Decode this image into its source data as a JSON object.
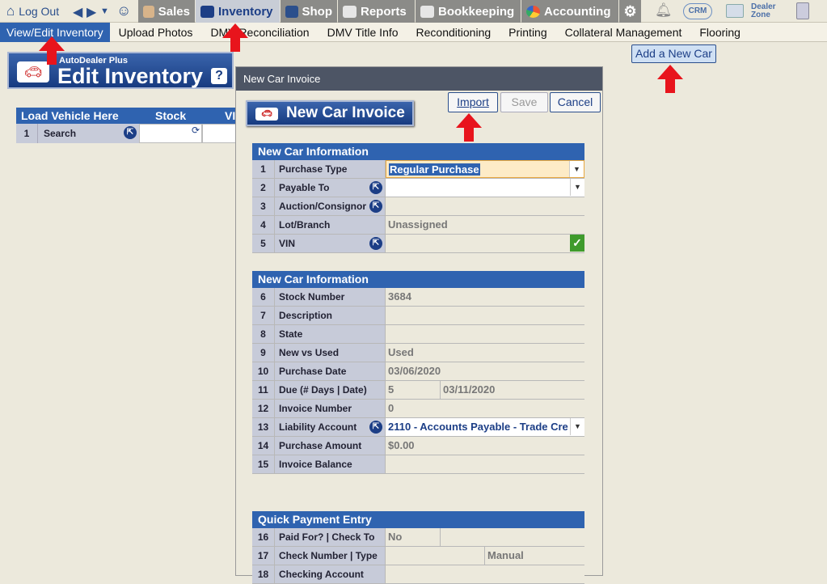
{
  "topnav": {
    "logout": "Log Out",
    "tabs": [
      {
        "label": "Sales",
        "icon": "salesperson-icon"
      },
      {
        "label": "Inventory",
        "icon": "car-icon"
      },
      {
        "label": "Shop",
        "icon": "wrench-icon"
      },
      {
        "label": "Reports",
        "icon": "report-icon"
      },
      {
        "label": "Bookkeeping",
        "icon": "book-icon"
      },
      {
        "label": "Accounting",
        "icon": "pie-chart-icon"
      }
    ],
    "crm": "CRM",
    "dealer_zone": "Dealer Zone"
  },
  "subnav": [
    "View/Edit Inventory",
    "Upload Photos",
    "DMV Reconciliation",
    "DMV Title Info",
    "Reconditioning",
    "Printing",
    "Collateral Management",
    "Flooring"
  ],
  "header": {
    "brand_small": "AutoDealer Plus",
    "title": "Edit Inventory",
    "help": "?"
  },
  "add_new_car": "Add a New Car",
  "load_table": {
    "headers": [
      "Load Vehicle Here",
      "Stock",
      "VI"
    ],
    "row_num": "1",
    "row_label": "Search"
  },
  "dialog": {
    "title": "New Car Invoice",
    "banner": "New Car Invoice",
    "import": "Import",
    "save": "Save",
    "cancel": "Cancel",
    "section1": {
      "title": "New Car Information",
      "rows": [
        {
          "n": "1",
          "label": "Purchase Type",
          "value": "Regular Purchase"
        },
        {
          "n": "2",
          "label": "Payable To",
          "value": ""
        },
        {
          "n": "3",
          "label": "Auction/Consignor",
          "value": ""
        },
        {
          "n": "4",
          "label": "Lot/Branch",
          "value": "Unassigned"
        },
        {
          "n": "5",
          "label": "VIN",
          "value": ""
        }
      ]
    },
    "section2": {
      "title": "New Car Information",
      "rows": [
        {
          "n": "6",
          "label": "Stock Number",
          "value": "3684"
        },
        {
          "n": "7",
          "label": "Description",
          "value": ""
        },
        {
          "n": "8",
          "label": "State",
          "value": ""
        },
        {
          "n": "9",
          "label": "New vs Used",
          "value": "Used"
        },
        {
          "n": "10",
          "label": "Purchase Date",
          "value": "03/06/2020"
        },
        {
          "n": "11",
          "label": "Due (# Days | Date)",
          "value": "5",
          "value2": "03/11/2020"
        },
        {
          "n": "12",
          "label": "Invoice Number",
          "value": "0"
        },
        {
          "n": "13",
          "label": "Liability Account",
          "value": "2110 - Accounts Payable - Trade Cre"
        },
        {
          "n": "14",
          "label": "Purchase Amount",
          "value": "$0.00"
        },
        {
          "n": "15",
          "label": "Invoice Balance",
          "value": ""
        }
      ]
    },
    "section3": {
      "title": "Quick Payment Entry",
      "rows": [
        {
          "n": "16",
          "label": "Paid For? | Check To",
          "value": "No",
          "value2": ""
        },
        {
          "n": "17",
          "label": "Check Number | Type",
          "value": "",
          "value2": "Manual"
        },
        {
          "n": "18",
          "label": "Checking Account",
          "value": ""
        }
      ]
    }
  }
}
